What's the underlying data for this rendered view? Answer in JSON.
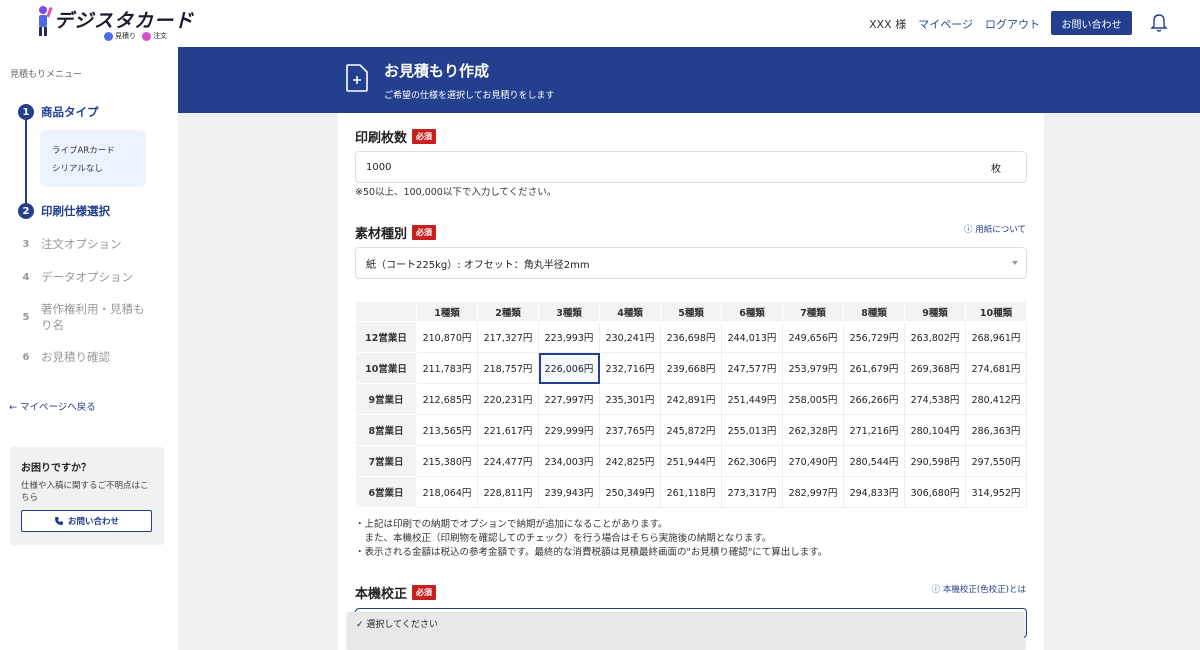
{
  "header": {
    "logo_text": "デジスタカード",
    "logo_tags": [
      "見積り",
      "注文"
    ],
    "user_name": "XXX 様",
    "links": [
      "マイページ",
      "ログアウト"
    ],
    "contact_label": "お問い合わせ"
  },
  "sidebar": {
    "title": "見積もりメニュー",
    "steps": [
      {
        "num": "1",
        "label": "商品タイプ",
        "state": "done"
      },
      {
        "num": "2",
        "label": "印刷仕様選択",
        "state": "active"
      },
      {
        "num": "3",
        "label": "注文オプション",
        "state": "todo"
      },
      {
        "num": "4",
        "label": "データオプション",
        "state": "todo"
      },
      {
        "num": "5",
        "label": "著作権利用・見積もり名",
        "state": "todo"
      },
      {
        "num": "6",
        "label": "お見積り確認",
        "state": "todo"
      }
    ],
    "selected_lines": [
      "ライブARカード",
      "シリアルなし"
    ],
    "back_link": "← マイページへ戻る",
    "help_title": "お困りですか？",
    "help_text": "仕様や入稿に関するご不明点はこちら",
    "help_button": "お問い合わせ"
  },
  "banner": {
    "title": "お見積もり作成",
    "subtitle": "ご希望の仕様を選択してお見積りをします"
  },
  "quantity": {
    "label": "印刷枚数",
    "required": "必須",
    "value": "1000",
    "unit": "枚",
    "note": "※50以上、100,000以下で入力してください。"
  },
  "material": {
    "label": "素材種別",
    "required": "必須",
    "info_link": "ⓘ 用紙について",
    "selected": "紙（コート225kg）: オフセット：角丸半径2mm"
  },
  "price_table": {
    "columns": [
      "1種類",
      "2種類",
      "3種類",
      "4種類",
      "5種類",
      "6種類",
      "7種類",
      "8種類",
      "9種類",
      "10種類"
    ],
    "rows": [
      {
        "label": "12営業日",
        "values": [
          "210,870円",
          "217,327円",
          "223,993円",
          "230,241円",
          "236,698円",
          "244,013円",
          "249,656円",
          "256,729円",
          "263,802円",
          "268,961円"
        ]
      },
      {
        "label": "10営業日",
        "values": [
          "211,783円",
          "218,757円",
          "226,006円",
          "232,716円",
          "239,668円",
          "247,577円",
          "253,979円",
          "261,679円",
          "269,368円",
          "274,681円"
        ]
      },
      {
        "label": "9営業日",
        "values": [
          "212,685円",
          "220,231円",
          "227,997円",
          "235,301円",
          "242,891円",
          "251,449円",
          "258,005円",
          "266,266円",
          "274,538円",
          "280,412円"
        ]
      },
      {
        "label": "8営業日",
        "values": [
          "213,565円",
          "221,617円",
          "229,999円",
          "237,765円",
          "245,872円",
          "255,013円",
          "262,328円",
          "271,216円",
          "280,104円",
          "286,363円"
        ]
      },
      {
        "label": "7営業日",
        "values": [
          "215,380円",
          "224,477円",
          "234,003円",
          "242,825円",
          "251,944円",
          "262,306円",
          "270,490円",
          "280,544円",
          "290,598円",
          "297,550円"
        ]
      },
      {
        "label": "6営業日",
        "values": [
          "218,064円",
          "228,811円",
          "239,943円",
          "250,349円",
          "261,118円",
          "273,317円",
          "282,997円",
          "294,833円",
          "306,680円",
          "314,952円"
        ]
      }
    ],
    "selected": {
      "row": 1,
      "col": 2
    }
  },
  "notes": [
    "・上記は印刷での納期でオプションで納期が追加になることがあります。",
    "　また、本機校正（印刷物を確認してのチェック）を行う場合はそちら実施後の納期となります。",
    "・表示される金額は税込の参考金額です。最終的な消費税額は見積最終画面の\"お見積り確認\"にて算出します。"
  ],
  "proof": {
    "label": "本機校正",
    "required": "必須",
    "info_link": "ⓘ 本機校正(色校正)とは",
    "dropdown_option": "✓ 選択してください"
  },
  "colors": {
    "primary": "#233f8e",
    "required": "#c9201f"
  }
}
